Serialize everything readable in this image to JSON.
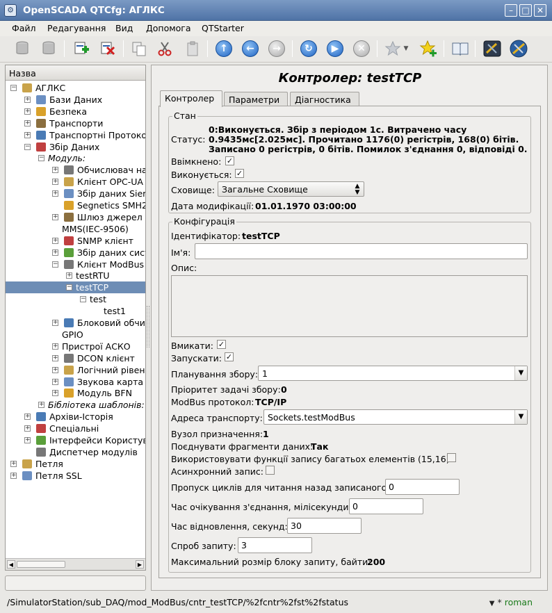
{
  "window": {
    "title": "OpenSCADA QTCfg: АГЛКС"
  },
  "menu": [
    "Файл",
    "Редагування",
    "Вид",
    "Допомога",
    "QTStarter"
  ],
  "toolbar": {
    "icons": [
      "db-load-icon",
      "db-save-icon",
      "add-item-icon",
      "delete-item-icon",
      "copy-icon",
      "cut-icon",
      "paste-icon",
      "up-icon",
      "back-icon",
      "forward-icon",
      "refresh-icon",
      "start-icon",
      "stop-icon",
      "bookmark-icon",
      "bookmark-dropdown-icon",
      "add-bookmark-icon",
      "manual-icon",
      "settings-tool-icon",
      "settings-tool-2-icon"
    ]
  },
  "tree": {
    "header": "Назва",
    "items": [
      {
        "label": "АГЛКС",
        "indent": 0,
        "exp": "-"
      },
      {
        "label": "Бази Даних",
        "indent": 1,
        "exp": "+"
      },
      {
        "label": "Безпека",
        "indent": 1,
        "exp": "+"
      },
      {
        "label": "Транспорти",
        "indent": 1,
        "exp": "+"
      },
      {
        "label": "Транспортні Протоко",
        "indent": 1,
        "exp": "+"
      },
      {
        "label": "Збір Даних",
        "indent": 1,
        "exp": "-"
      },
      {
        "label": "Модуль:",
        "indent": 2,
        "exp": "-",
        "italic": true
      },
      {
        "label": "Обчислювач на",
        "indent": 3,
        "exp": "+"
      },
      {
        "label": "Клієнт OPC-UA",
        "indent": 3,
        "exp": "+"
      },
      {
        "label": "Збір даних Sier",
        "indent": 3,
        "exp": "+"
      },
      {
        "label": "Segnetics SMH2",
        "indent": 3,
        "exp": ""
      },
      {
        "label": "Шлюз джерел ,",
        "indent": 3,
        "exp": "+"
      },
      {
        "label": "MMS(IEC-9506)",
        "indent": 3,
        "exp": "",
        "noicon": true
      },
      {
        "label": "SNMP клієнт",
        "indent": 3,
        "exp": "+"
      },
      {
        "label": "Збір даних сист",
        "indent": 3,
        "exp": "+"
      },
      {
        "label": "Клієнт ModBus",
        "indent": 3,
        "exp": "-"
      },
      {
        "label": "testRTU",
        "indent": 4,
        "exp": "+",
        "noicon": true
      },
      {
        "label": "testTCP",
        "indent": 4,
        "exp": "-",
        "noicon": true,
        "selected": true
      },
      {
        "label": "test",
        "indent": 5,
        "exp": "-",
        "noicon": true
      },
      {
        "label": "test1",
        "indent": 6,
        "exp": "",
        "noicon": true
      },
      {
        "label": "Блоковий обчис",
        "indent": 3,
        "exp": "+"
      },
      {
        "label": "GPIO",
        "indent": 3,
        "exp": "",
        "noicon": true
      },
      {
        "label": "Пристрої АСКО",
        "indent": 3,
        "exp": "+",
        "noicon": true
      },
      {
        "label": "DCON клієнт",
        "indent": 3,
        "exp": "+"
      },
      {
        "label": "Логічний рівень",
        "indent": 3,
        "exp": "+"
      },
      {
        "label": "Звукова карта",
        "indent": 3,
        "exp": "+"
      },
      {
        "label": "Модуль BFN",
        "indent": 3,
        "exp": "+"
      },
      {
        "label": "Бібліотека шаблонів:",
        "indent": 2,
        "exp": "+",
        "italic": true
      },
      {
        "label": "Архіви-Історія",
        "indent": 1,
        "exp": "+"
      },
      {
        "label": "Спеціальні",
        "indent": 1,
        "exp": "+"
      },
      {
        "label": "Інтерфейси Користув",
        "indent": 1,
        "exp": "+"
      },
      {
        "label": "Диспетчер модулів",
        "indent": 1,
        "exp": ""
      },
      {
        "label": "Петля",
        "indent": 0,
        "exp": "+"
      },
      {
        "label": "Петля SSL",
        "indent": 0,
        "exp": "+"
      }
    ]
  },
  "main": {
    "title": "Контролер: testTCP",
    "tabs": [
      "Контролер",
      "Параметри",
      "Діагностика"
    ],
    "state": {
      "caption": "Стан",
      "status_label": "Статус:",
      "status_lines": [
        "0:Виконується. Збір з періодом 1с. Витрачено часу",
        "0.9435мс[2.025мс]. Прочитано 1176(0) регістрів, 168(0) бітів.",
        "Записано 0 регістрів, 0 бітів. Помилок з'єднання 0, відповіді 0."
      ],
      "enabled_label": "Ввімкнено:",
      "running_label": "Виконується:",
      "storage_label": "Сховище:",
      "storage_value": "Загальне Сховище",
      "modified_label": "Дата модифікації:",
      "modified_value": "01.01.1970 03:00:00"
    },
    "config": {
      "caption": "Конфігурація",
      "id_label": "Ідентифікатор:",
      "id_value": "testTCP",
      "name_label": "Ім'я:",
      "name_value": "",
      "descr_label": "Опис:",
      "enable_label": "Вмикати:",
      "start_label": "Запускати:",
      "schedule_label": "Планування збору:",
      "schedule_value": "1",
      "priority_label": "Пріоритет задачі збору:",
      "priority_value": "0",
      "protocol_label": "ModBus протокол:",
      "protocol_value": "TCP/IP",
      "transport_label": "Адреса транспорту:",
      "transport_value": "Sockets.testModBus",
      "node_label": "Вузол призначення:",
      "node_value": "1",
      "merge_label": "Поєднувати фрагменти даних:",
      "merge_value": "Так",
      "multiwrite_label": "Використовувати функції запису багатьох елементів (15,16):",
      "async_label": "Асинхронний запис:",
      "skip_label": "Пропуск циклів для читання назад записаного:",
      "skip_value": "0",
      "conn_tm_label": "Час очікування з'єднання, мілісекунди:",
      "conn_tm_value": "0",
      "restore_label": "Час відновлення, секунд:",
      "restore_value": "30",
      "retries_label": "Спроб запиту:",
      "retries_value": "3",
      "maxblock_label": "Максимальний розмір блоку запиту, байти:",
      "maxblock_value": "200"
    }
  },
  "statusbar": {
    "path": "/SimulatorStation/sub_DAQ/mod_ModBus/cntr_testTCP/%2fcntr%2fst%2fstatus",
    "user": "roman",
    "marks": "* "
  }
}
